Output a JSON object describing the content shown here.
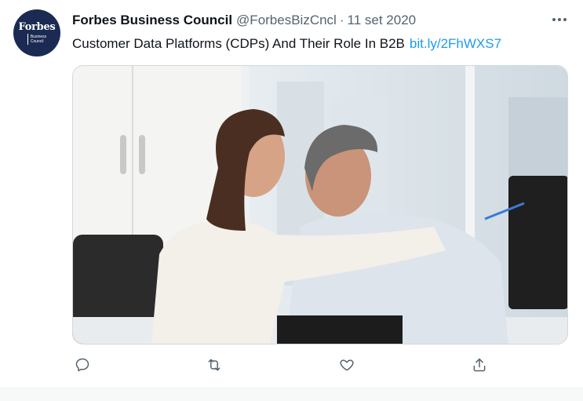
{
  "author": {
    "name": "Forbes Business Council",
    "handle": "@ForbesBizCncl",
    "separator": "·",
    "date": "11 set 2020",
    "avatar_brand": "Forbes",
    "avatar_sub_line1": "Business",
    "avatar_sub_line2": "Council",
    "avatar_color": "#1a2a52"
  },
  "tweet": {
    "text": "Customer Data Platforms (CDPs) And Their Role In B2B",
    "link": "bit.ly/2FhWXS7"
  },
  "media": {
    "description_icon": "photo-of-two-colleagues-at-computer"
  },
  "actions": [
    {
      "icon": "reply-icon"
    },
    {
      "icon": "retweet-icon"
    },
    {
      "icon": "like-icon"
    },
    {
      "icon": "share-icon"
    }
  ],
  "colors": {
    "link": "#1d9bf0",
    "secondary_text": "#536471",
    "primary_text": "#0f1419"
  }
}
